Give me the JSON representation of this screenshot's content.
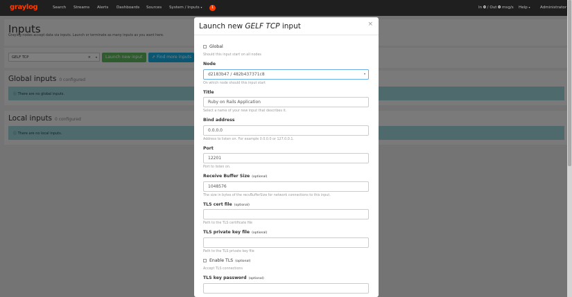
{
  "nav": {
    "brand": "graylog",
    "items": [
      "Search",
      "Streams",
      "Alerts",
      "Dashboards",
      "Sources"
    ],
    "system_menu": "System / Inputs",
    "notifications_count": "1",
    "throughput_in_label": "In",
    "throughput_in": "0",
    "throughput_sep": "/ Out",
    "throughput_out": "0",
    "throughput_unit": "msg/s",
    "help": "Help",
    "user": "Administrator"
  },
  "page": {
    "title": "Inputs",
    "description": "Graylog nodes accept data via inputs. Launch or terminate as many inputs as you want here.",
    "input_type_selected": "GELF TCP",
    "launch_button": "Launch new input",
    "find_more_button": "Find more inputs",
    "global_title": "Global inputs",
    "global_count": "0 configured",
    "global_empty": "There are no global inputs.",
    "local_title": "Local inputs",
    "local_count": "0 configured",
    "local_empty": "There are no local inputs."
  },
  "modal": {
    "title_prefix": "Launch new",
    "title_type": "GELF TCP",
    "title_suffix": "input",
    "close_icon": "×",
    "global_label": "Global",
    "global_help": "Should this input start on all nodes",
    "node_label": "Node",
    "node_value": "d2183b47 / 482b437371c8",
    "node_help": "On which node should this input start",
    "title_label": "Title",
    "title_value": "Ruby on Rails Application",
    "title_help": "Select a name of your new input that describes it.",
    "bind_label": "Bind address",
    "bind_value": "0.0.0.0",
    "bind_help": "Address to listen on. For example 0.0.0.0 or 127.0.0.1.",
    "port_label": "Port",
    "port_value": "12201",
    "port_help": "Port to listen on.",
    "rbs_label": "Receive Buffer Size",
    "optional": "(optional)",
    "rbs_value": "1048576",
    "rbs_help": "The size in bytes of the recvBufferSize for network connections to this input.",
    "tls_cert_label": "TLS cert file",
    "tls_cert_value": "",
    "tls_cert_help": "Path to the TLS certificate file",
    "tls_key_label": "TLS private key file",
    "tls_key_value": "",
    "tls_key_help": "Path to the TLS private key file",
    "enable_tls_label": "Enable TLS",
    "enable_tls_help": "Accept TLS connections",
    "tls_pass_label": "TLS key password",
    "tls_pass_value": ""
  }
}
